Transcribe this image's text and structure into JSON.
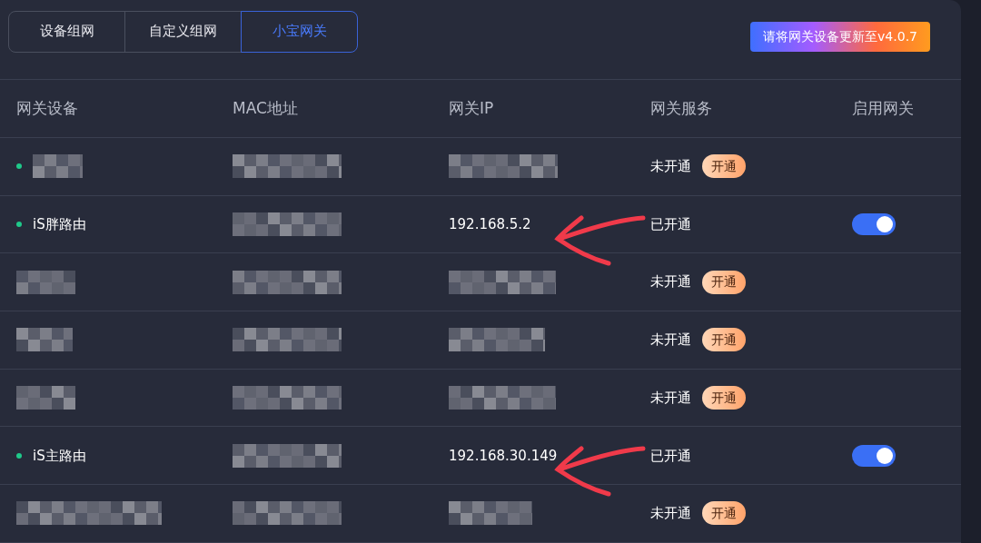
{
  "tabs": [
    {
      "label": "设备组网",
      "selected": false
    },
    {
      "label": "自定义组网",
      "selected": false
    },
    {
      "label": "小宝网关",
      "selected": true
    }
  ],
  "update_notice": "请将网关设备更新至v4.0.7",
  "table": {
    "columns": [
      "网关设备",
      "MAC地址",
      "网关IP",
      "网关服务",
      "启用网关"
    ],
    "rows": [
      {
        "online": true,
        "device": {
          "redacted": true
        },
        "mac": {
          "redacted": true
        },
        "ip": {
          "redacted": true
        },
        "service": "未开通",
        "action": "开通",
        "arrow": false
      },
      {
        "online": true,
        "device": {
          "text": "iS胖路由"
        },
        "mac": {
          "redacted": true
        },
        "ip": {
          "text": "192.168.5.2"
        },
        "service": "已开通",
        "enabled": true,
        "arrow": true
      },
      {
        "online": false,
        "device": {
          "redacted": true
        },
        "mac": {
          "redacted": true
        },
        "ip": {
          "redacted": true
        },
        "service": "未开通",
        "action": "开通",
        "arrow": false
      },
      {
        "online": false,
        "device": {
          "redacted": true
        },
        "mac": {
          "redacted": true
        },
        "ip": {
          "redacted": true
        },
        "service": "未开通",
        "action": "开通",
        "arrow": false
      },
      {
        "online": false,
        "device": {
          "redacted": true
        },
        "mac": {
          "redacted": true
        },
        "ip": {
          "redacted": true
        },
        "service": "未开通",
        "action": "开通",
        "arrow": false
      },
      {
        "online": true,
        "device": {
          "text": "iS主路由"
        },
        "mac": {
          "redacted": true
        },
        "ip": {
          "text": "192.168.30.149"
        },
        "service": "已开通",
        "enabled": true,
        "arrow": true
      },
      {
        "online": false,
        "device": {
          "redacted": true
        },
        "mac": {
          "redacted": true
        },
        "ip": {
          "redacted": true
        },
        "service": "未开通",
        "action": "开通",
        "arrow": false
      }
    ]
  }
}
